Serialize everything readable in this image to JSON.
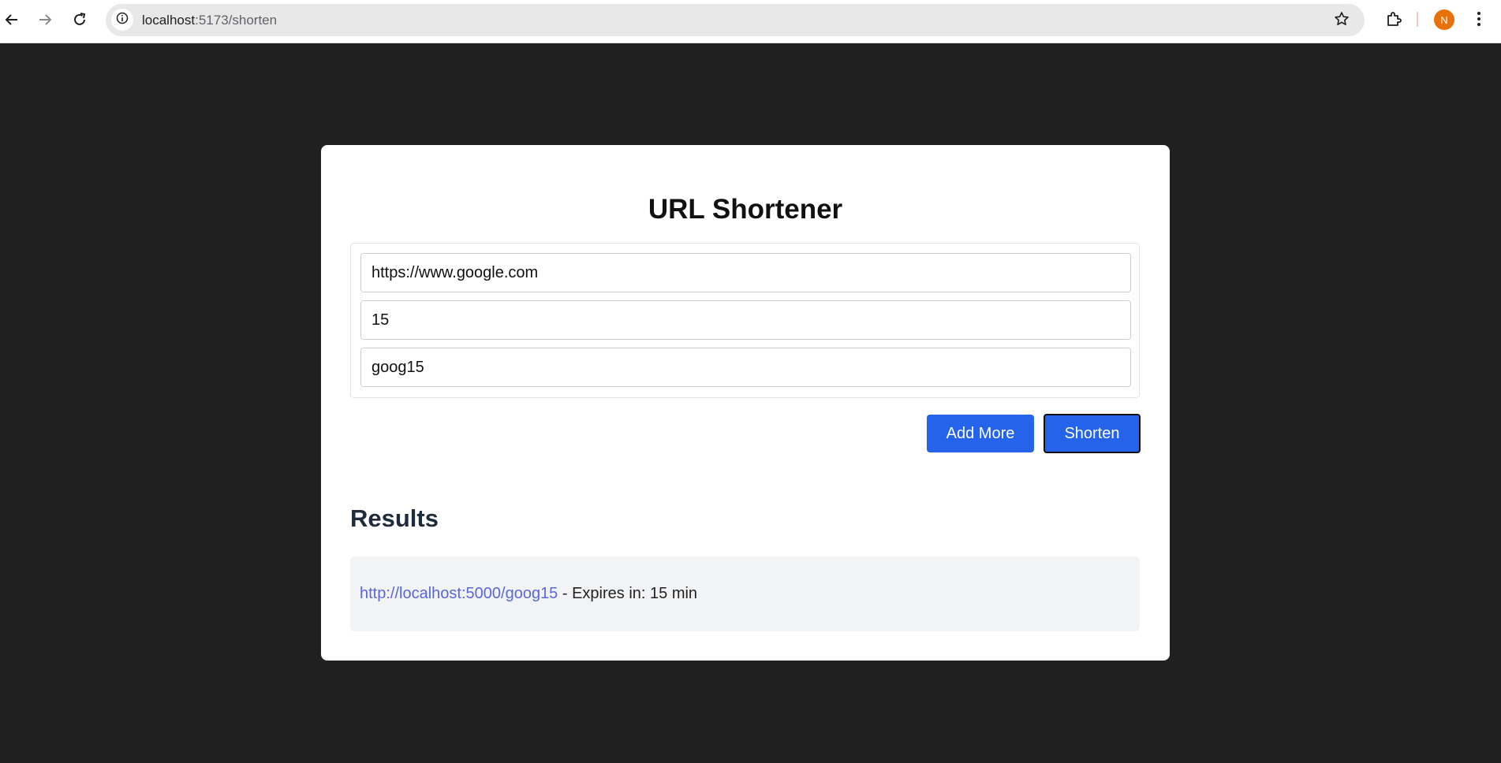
{
  "browser": {
    "url_host": "localhost",
    "url_path": ":5173/shorten",
    "profile_initial": "N",
    "icons": [
      "back-icon",
      "forward-icon",
      "reload-icon",
      "site-info-icon",
      "bookmark-star-icon",
      "extensions-icon",
      "more-menu-icon"
    ]
  },
  "app": {
    "title": "URL Shortener",
    "inputs": {
      "url_value": "https://www.google.com",
      "validity_value": "15",
      "shortcode_value": "goog15"
    },
    "buttons": {
      "add_more": "Add More",
      "shorten": "Shorten"
    },
    "results": {
      "heading": "Results",
      "items": [
        {
          "short_url": "http://localhost:5000/goog15",
          "expiry_text": " - Expires in: 15 min"
        }
      ]
    }
  },
  "colors": {
    "page_bg": "#202020",
    "button_bg": "#2563eb",
    "link": "#5a67d8",
    "avatar": "#e8710a"
  }
}
